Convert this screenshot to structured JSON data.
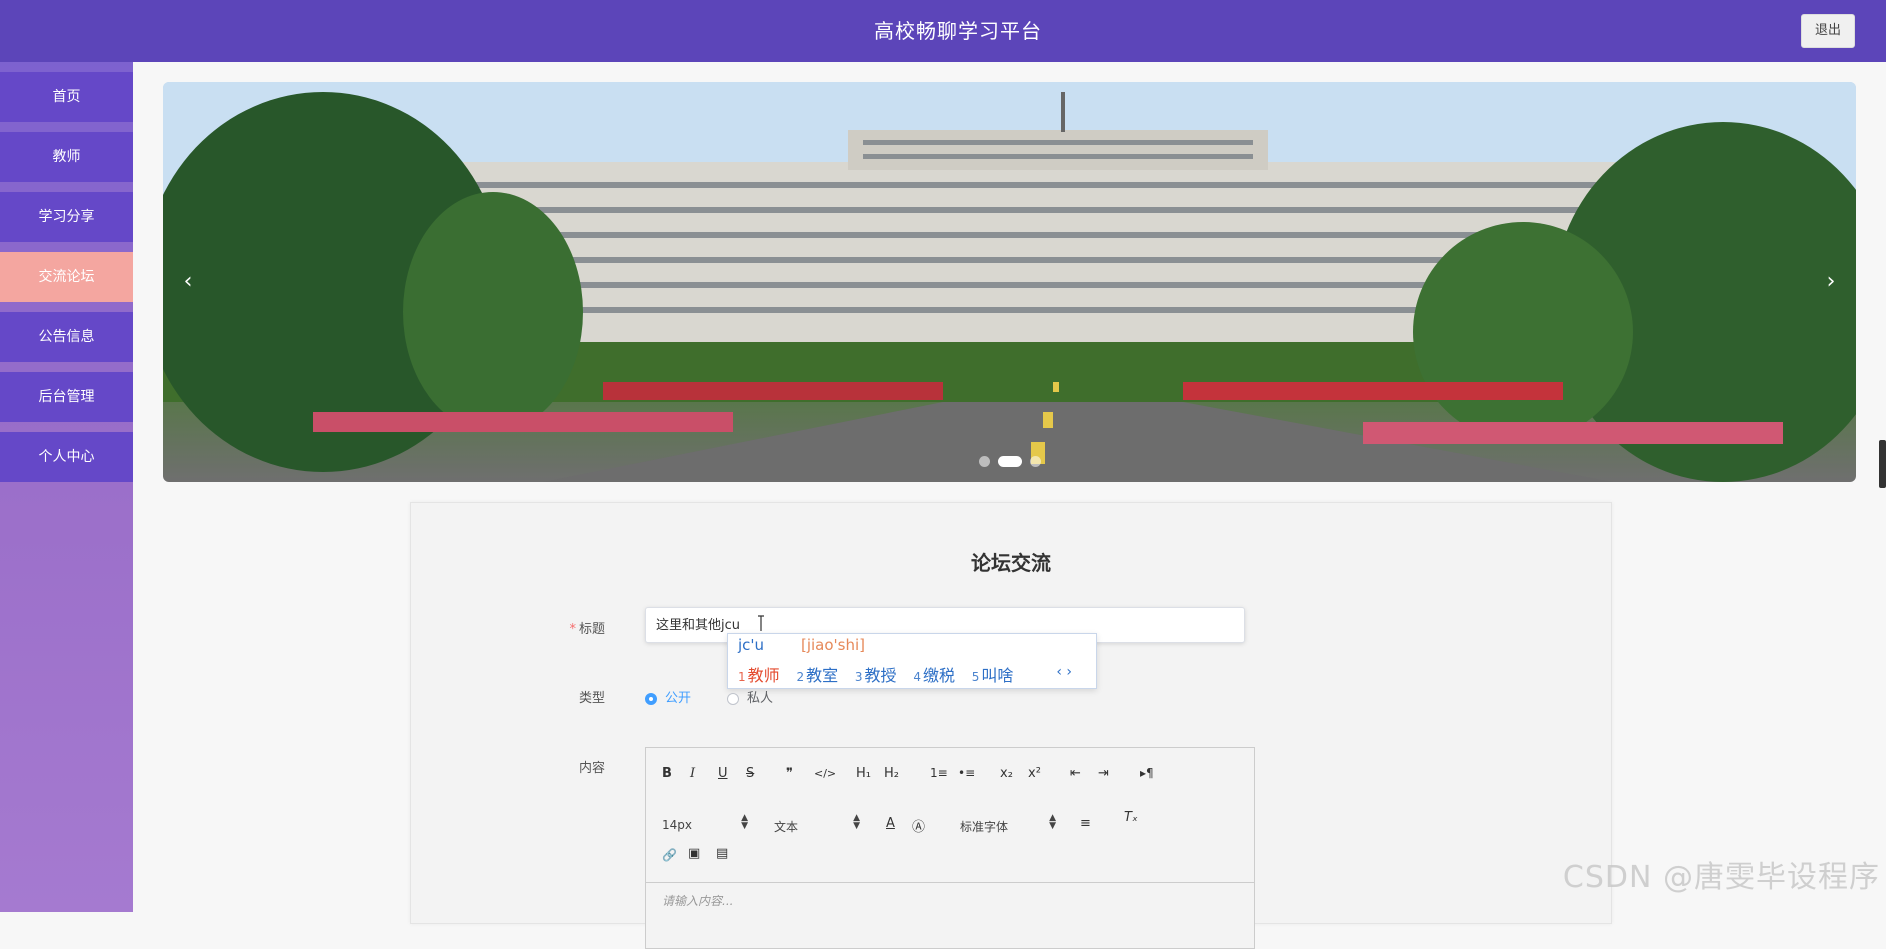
{
  "header": {
    "title": "高校畅聊学习平台",
    "logout_label": "退出"
  },
  "sidebar": {
    "items": [
      {
        "label": "首页",
        "active": false
      },
      {
        "label": "教师",
        "active": false
      },
      {
        "label": "学习分享",
        "active": false
      },
      {
        "label": "交流论坛",
        "active": true
      },
      {
        "label": "公告信息",
        "active": false
      },
      {
        "label": "后台管理",
        "active": false
      },
      {
        "label": "个人中心",
        "active": false
      }
    ]
  },
  "banner": {
    "prev_icon": "‹",
    "next_icon": "›",
    "slides": 3,
    "active_slide": 2
  },
  "form": {
    "title": "论坛交流",
    "title_field": {
      "required_mark": "*",
      "label": "标题",
      "value": "这里和其他jcu"
    },
    "ime": {
      "composition": "jc'u",
      "pinyin": "[jiao'shi]",
      "candidates": [
        {
          "num": "1",
          "text": "教师"
        },
        {
          "num": "2",
          "text": "教室"
        },
        {
          "num": "3",
          "text": "教授"
        },
        {
          "num": "4",
          "text": "缴税"
        },
        {
          "num": "5",
          "text": "叫啥"
        }
      ],
      "pager": "‹ ›"
    },
    "type_field": {
      "label": "类型",
      "options": [
        {
          "label": "公开",
          "checked": true
        },
        {
          "label": "私人",
          "checked": false
        }
      ]
    },
    "content_field": {
      "label": "内容",
      "toolbar": {
        "bold": "B",
        "italic": "I",
        "underline": "U",
        "strike": "S",
        "quote": "❞",
        "code": "</>",
        "h1": "H₁",
        "h2": "H₂",
        "ordered_list": "1≡",
        "bullet_list": "•≡",
        "subscript": "x₂",
        "superscript": "x²",
        "outdent": "⇤",
        "indent": "⇥",
        "rtl": "▸¶",
        "size": "14px",
        "header": "文本",
        "color": "A",
        "background": "Ⓐ",
        "font": "标准字体",
        "align": "≡",
        "clean": "Tₓ",
        "link": "🔗",
        "image": "▣",
        "video": "▤"
      },
      "placeholder": "请输入内容..."
    }
  },
  "watermark": "CSDN @唐雯毕设程序"
}
